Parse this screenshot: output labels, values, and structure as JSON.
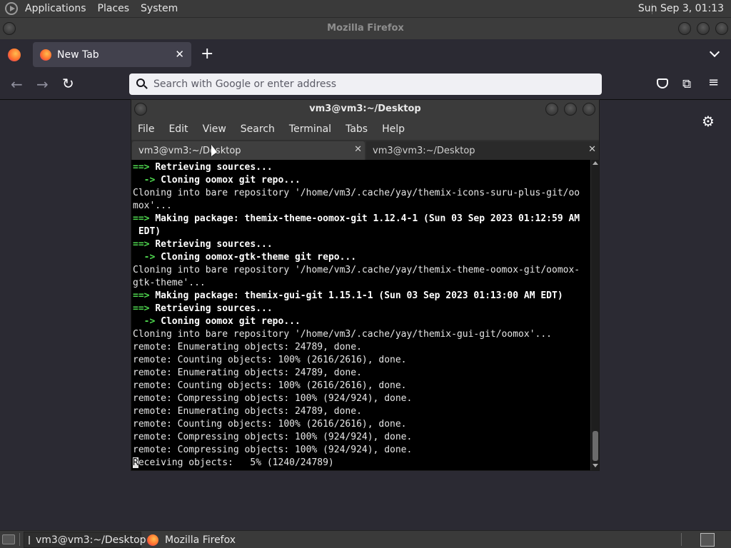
{
  "top_panel": {
    "menus": [
      "Applications",
      "Places",
      "System"
    ],
    "clock": "Sun Sep  3, 01:13"
  },
  "firefox": {
    "window_title": "Mozilla Firefox",
    "tab_label": "New Tab",
    "url_placeholder": "Search with Google or enter address"
  },
  "terminal": {
    "window_title": "vm3@vm3:~/Desktop",
    "menus": [
      "File",
      "Edit",
      "View",
      "Search",
      "Terminal",
      "Tabs",
      "Help"
    ],
    "tabs": [
      "vm3@vm3:~/Desktop",
      "vm3@vm3:~/Desktop"
    ],
    "lines": [
      [
        {
          "t": "==> ",
          "c": "g"
        },
        {
          "t": "Retrieving sources...",
          "c": "b"
        }
      ],
      [
        {
          "t": "  -> ",
          "c": "g"
        },
        {
          "t": "Cloning oomox git repo...",
          "c": "b"
        }
      ],
      [
        {
          "t": "Cloning into bare repository '/home/vm3/.cache/yay/themix-icons-suru-plus-git/oo",
          "c": ""
        }
      ],
      [
        {
          "t": "mox'...",
          "c": ""
        }
      ],
      [
        {
          "t": "==> ",
          "c": "g"
        },
        {
          "t": "Making package: themix-theme-oomox-git 1.12.4-1 (Sun 03 Sep 2023 01:12:59 AM",
          "c": "b"
        }
      ],
      [
        {
          "t": " EDT)",
          "c": "b"
        }
      ],
      [
        {
          "t": "==> ",
          "c": "g"
        },
        {
          "t": "Retrieving sources...",
          "c": "b"
        }
      ],
      [
        {
          "t": "  -> ",
          "c": "g"
        },
        {
          "t": "Cloning oomox-gtk-theme git repo...",
          "c": "b"
        }
      ],
      [
        {
          "t": "Cloning into bare repository '/home/vm3/.cache/yay/themix-theme-oomox-git/oomox-",
          "c": ""
        }
      ],
      [
        {
          "t": "gtk-theme'...",
          "c": ""
        }
      ],
      [
        {
          "t": "==> ",
          "c": "g"
        },
        {
          "t": "Making package: themix-gui-git 1.15.1-1 (Sun 03 Sep 2023 01:13:00 AM EDT)",
          "c": "b"
        }
      ],
      [
        {
          "t": "==> ",
          "c": "g"
        },
        {
          "t": "Retrieving sources...",
          "c": "b"
        }
      ],
      [
        {
          "t": "  -> ",
          "c": "g"
        },
        {
          "t": "Cloning oomox git repo...",
          "c": "b"
        }
      ],
      [
        {
          "t": "Cloning into bare repository '/home/vm3/.cache/yay/themix-gui-git/oomox'...",
          "c": ""
        }
      ],
      [
        {
          "t": "remote: Enumerating objects: 24789, done.",
          "c": ""
        }
      ],
      [
        {
          "t": "remote: Counting objects: 100% (2616/2616), done.",
          "c": ""
        }
      ],
      [
        {
          "t": "remote: Enumerating objects: 24789, done.",
          "c": ""
        }
      ],
      [
        {
          "t": "remote: Counting objects: 100% (2616/2616), done.",
          "c": ""
        }
      ],
      [
        {
          "t": "remote: Compressing objects: 100% (924/924), done.",
          "c": ""
        }
      ],
      [
        {
          "t": "remote: Enumerating objects: 24789, done.",
          "c": ""
        }
      ],
      [
        {
          "t": "remote: Counting objects: 100% (2616/2616), done.",
          "c": ""
        }
      ],
      [
        {
          "t": "remote: Compressing objects: 100% (924/924), done.",
          "c": ""
        }
      ],
      [
        {
          "t": "remote: Compressing objects: 100% (924/924), done.",
          "c": ""
        }
      ],
      [
        {
          "t": "Receiving objects:   5% (1240/24789)",
          "c": ""
        }
      ]
    ]
  },
  "taskbar": {
    "items": [
      "vm3@vm3:~/Desktop",
      "Mozilla Firefox"
    ]
  }
}
